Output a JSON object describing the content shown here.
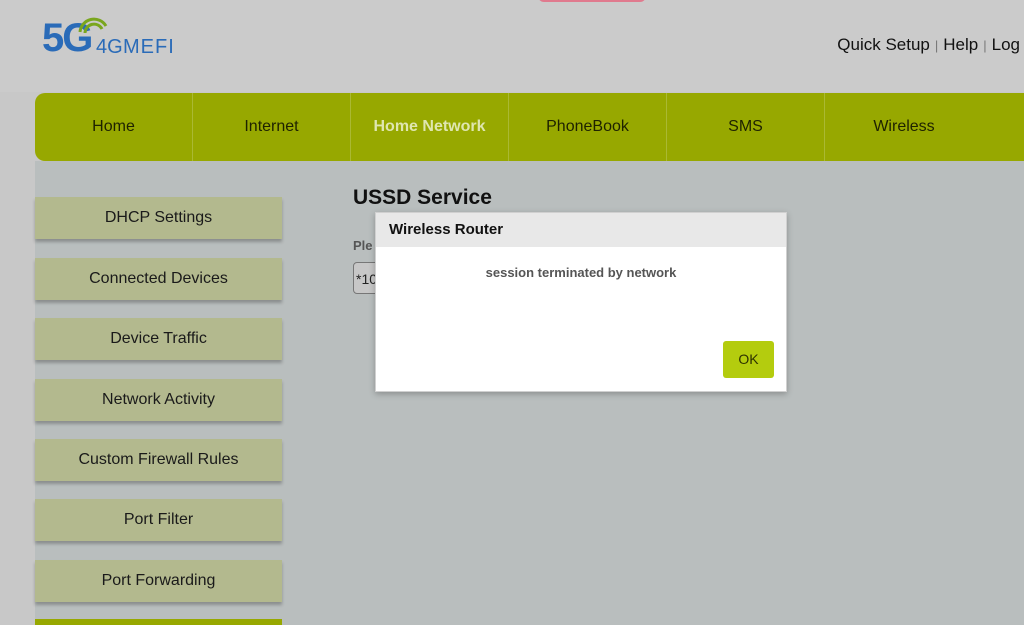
{
  "logo": {
    "five_g": "5G",
    "four_g": "4G",
    "brand": "MEFI"
  },
  "toplinks": {
    "quick_setup": "Quick Setup",
    "help": "Help",
    "log": "Log",
    "separator": "|"
  },
  "nav": [
    {
      "label": "Home"
    },
    {
      "label": "Internet"
    },
    {
      "label": "Home Network",
      "active": true
    },
    {
      "label": "PhoneBook"
    },
    {
      "label": "SMS"
    },
    {
      "label": "Wireless"
    }
  ],
  "sidebar": [
    {
      "label": "DHCP Settings"
    },
    {
      "label": "Connected Devices"
    },
    {
      "label": "Device Traffic"
    },
    {
      "label": "Network Activity"
    },
    {
      "label": "Custom Firewall Rules"
    },
    {
      "label": "Port Filter"
    },
    {
      "label": "Port Forwarding"
    }
  ],
  "main": {
    "title": "USSD Service",
    "label_partial": "Ple",
    "input_value": "*10"
  },
  "dialog": {
    "title": "Wireless Router",
    "message": "session terminated by network",
    "ok_label": "OK"
  },
  "colors": {
    "nav_bg": "#97a800",
    "ok_button": "#b4cc0e",
    "logo_blue": "#2a6bb8",
    "sidebar_btn": "#b3b98e"
  }
}
